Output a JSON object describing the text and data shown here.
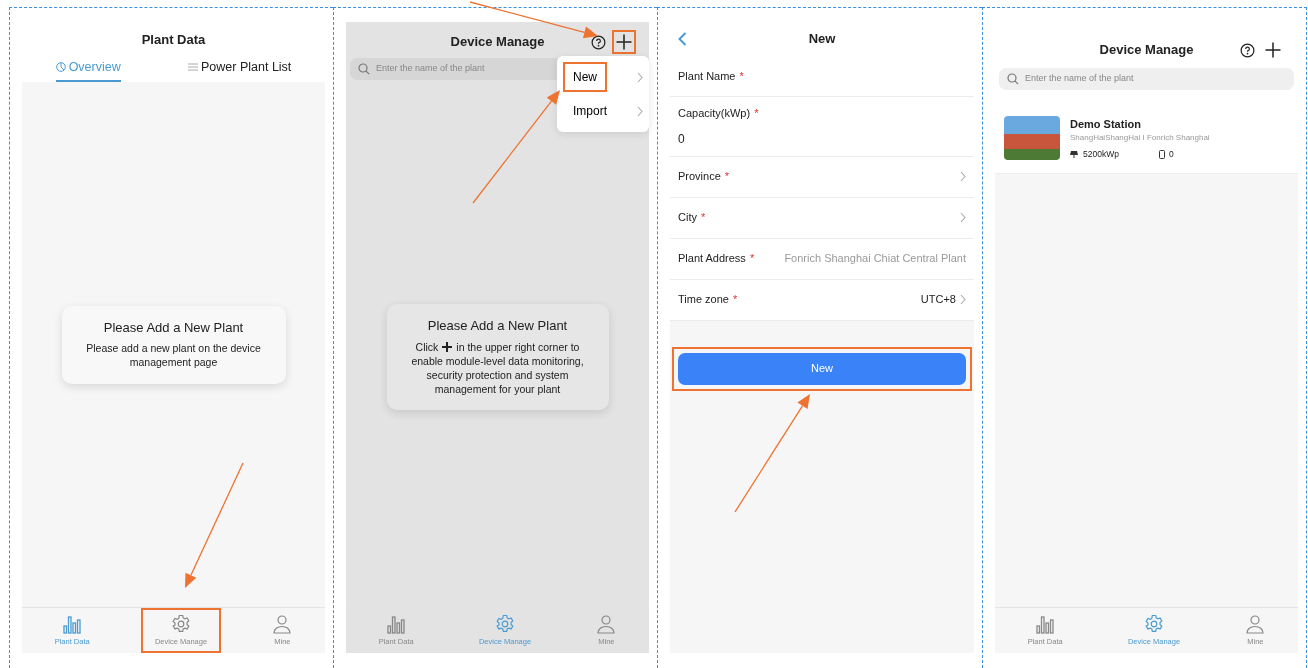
{
  "screens": [
    {
      "kind": "plant_data",
      "dimmed": false,
      "title": "Plant Data",
      "tabs": [
        {
          "label": "Overview",
          "selected": true
        },
        {
          "label": "Power Plant List",
          "selected": false
        }
      ],
      "empty_card": {
        "title": "Please Add a New Plant",
        "text_parts": [
          "Please add a new plant on the device management page"
        ]
      },
      "nav": [
        {
          "label": "Plant Data",
          "selected": true,
          "highlighted": false
        },
        {
          "label": "Device Manage",
          "selected": false,
          "highlighted": true
        },
        {
          "label": "Mine",
          "selected": false,
          "highlighted": false
        }
      ]
    },
    {
      "kind": "device_manage",
      "dimmed": true,
      "title": "Device Manage",
      "plus_highlighted": true,
      "search": {
        "placeholder": "Enter the name of the plant"
      },
      "menu": [
        {
          "label": "New",
          "highlighted": true
        },
        {
          "label": "Import",
          "highlighted": false
        }
      ],
      "empty_card": {
        "title": "Please Add a New Plant",
        "text_parts": [
          "Click",
          "in the upper right corner to",
          "enable module-level data monitoring, security protection and system management for your plant"
        ]
      },
      "nav": [
        {
          "label": "Plant Data",
          "selected": false,
          "highlighted": false
        },
        {
          "label": "Device Manage",
          "selected": true,
          "highlighted": false
        },
        {
          "label": "Mine",
          "selected": false,
          "highlighted": false
        }
      ]
    },
    {
      "kind": "form",
      "dimmed": false,
      "title": "New",
      "fields": [
        {
          "kind": "text",
          "label": "Plant Name",
          "required_mark": "*"
        },
        {
          "kind": "stacked",
          "label": "Capacity(kWp)",
          "required_mark": "*",
          "value": "0"
        },
        {
          "kind": "select",
          "label": "Province",
          "required_mark": "*"
        },
        {
          "kind": "select",
          "label": "City",
          "required_mark": "*"
        },
        {
          "kind": "text",
          "label": "Plant Address",
          "required_mark": "*",
          "placeholder": "Fonrich Shanghai Chiat Central Plant"
        },
        {
          "kind": "select",
          "label": "Time zone",
          "required_mark": "*",
          "value": "UTC+8"
        }
      ],
      "submit": {
        "label": "New",
        "highlighted": true
      }
    },
    {
      "kind": "device_list",
      "dimmed": false,
      "title": "Device Manage",
      "plus_highlighted": false,
      "search": {
        "placeholder": "Enter the name of the plant"
      },
      "stations": [
        {
          "name": "Demo Station",
          "location": "ShangHaiShangHai I Fonrich Shanghai",
          "capacity": "5200kWp",
          "devices": "0"
        }
      ],
      "nav": [
        {
          "label": "Plant Data",
          "selected": false,
          "highlighted": false
        },
        {
          "label": "Device Manage",
          "selected": true,
          "highlighted": false
        },
        {
          "label": "Mine",
          "selected": false,
          "highlighted": false
        }
      ]
    }
  ]
}
